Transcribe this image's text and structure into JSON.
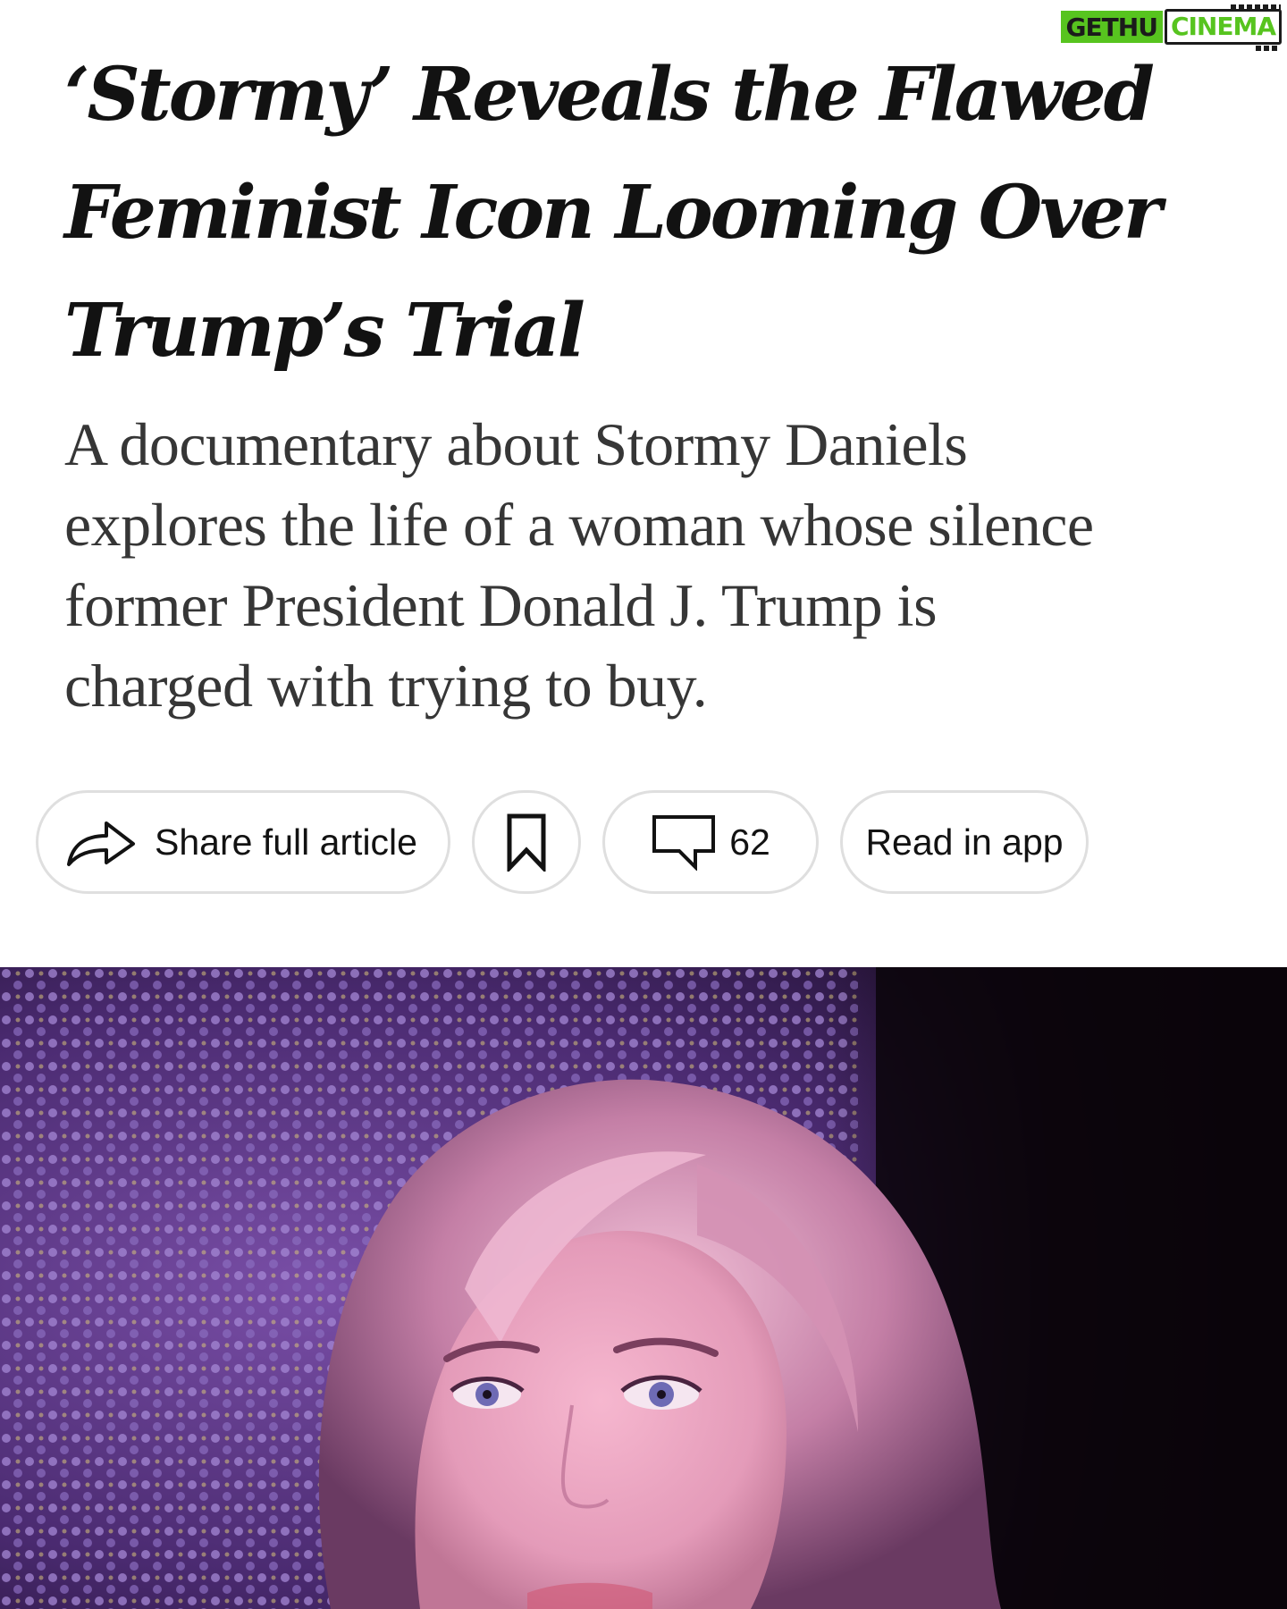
{
  "watermark": {
    "part1": "GETHU",
    "part2": "CINEMA"
  },
  "article": {
    "headline_line1": "‘Stormy’ Reveals the Flawed",
    "headline_line2": "Feminist Icon Looming Over",
    "headline_line3": "Trump’s Trial",
    "summary_line1": "A documentary about Stormy Daniels",
    "summary_line2": "explores the life of a woman whose silence",
    "summary_line3": "former President Donald J. Trump is",
    "summary_line4": "charged with trying to buy."
  },
  "actions": {
    "share_label": "Share full article",
    "comments_count": "62",
    "read_in_app_label": "Read in app"
  },
  "icons": {
    "share": "share-arrow-icon",
    "save": "bookmark-icon",
    "comments": "comment-bubble-icon"
  },
  "colors": {
    "text": "#121212",
    "summary_text": "#363636",
    "pill_border": "#dfdfdf",
    "watermark_green": "#57c41f"
  }
}
